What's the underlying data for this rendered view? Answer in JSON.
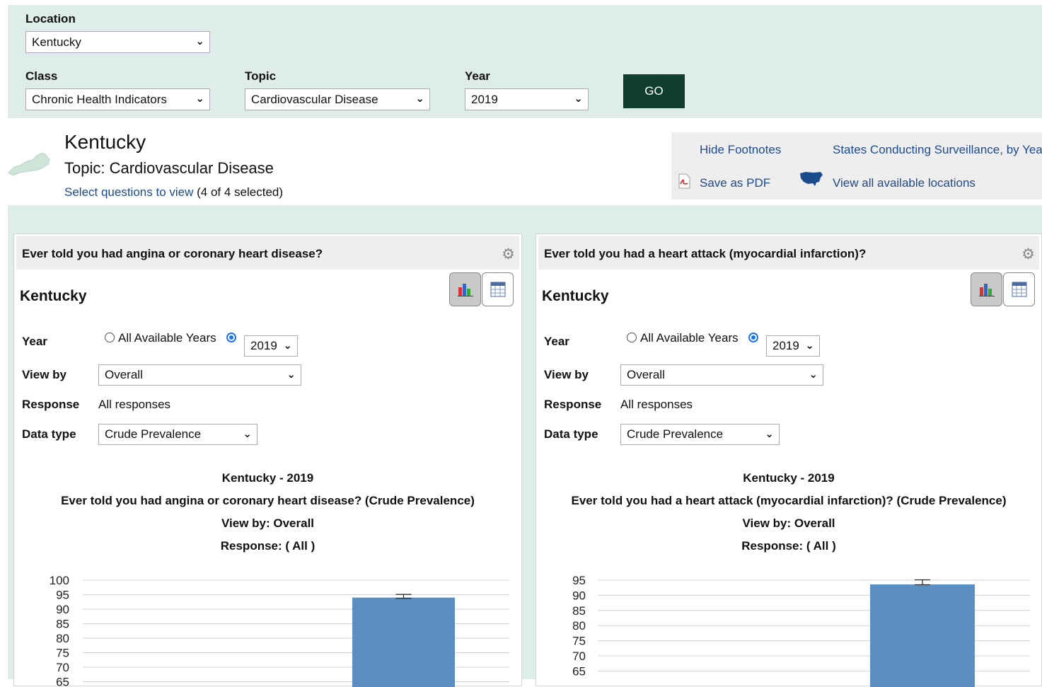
{
  "filters": {
    "location_label": "Location",
    "location_value": "Kentucky",
    "class_label": "Class",
    "class_value": "Chronic Health Indicators",
    "topic_label": "Topic",
    "topic_value": "Cardiovascular Disease",
    "year_label": "Year",
    "year_value": "2019",
    "go_label": "GO"
  },
  "header": {
    "state": "Kentucky",
    "topic": "Topic: Cardiovascular Disease",
    "select_link": "Select questions to view",
    "selected_count": "(4 of 4 selected)"
  },
  "links": {
    "hide_footnotes": "Hide Footnotes",
    "states_surveillance": "States Conducting Surveillance, by Year",
    "save_pdf": "Save as PDF",
    "view_locations": "View all available locations"
  },
  "icons": {
    "gear": "gear-icon",
    "bar_chart": "bar-chart-icon",
    "table": "table-icon",
    "pdf": "pdf-icon",
    "us_map": "us-map-icon",
    "state_map": "kentucky-map-icon"
  },
  "colors": {
    "band": "#dfede8",
    "go_button": "#0f3d2e",
    "link": "#1e4a8a",
    "bar": "#5b8fc3",
    "radio": "#1a73e8"
  },
  "panels": [
    {
      "question": "Ever told you had angina or coronary heart disease?",
      "state": "Kentucky",
      "year_label": "Year",
      "all_years_label": "All Available Years",
      "year_value": "2019",
      "viewby_label": "View by",
      "viewby_value": "Overall",
      "response_label": "Response",
      "response_value": "All responses",
      "datatype_label": "Data type",
      "datatype_value": "Crude Prevalence",
      "chart_title_1": "Kentucky - 2019",
      "chart_title_2": "Ever told you had angina or coronary heart disease? (Crude Prevalence)",
      "chart_title_3": "View by: Overall",
      "chart_title_4": "Response: ( All )"
    },
    {
      "question": "Ever told you had a heart attack (myocardial infarction)?",
      "state": "Kentucky",
      "year_label": "Year",
      "all_years_label": "All Available Years",
      "year_value": "2019",
      "viewby_label": "View by",
      "viewby_value": "Overall",
      "response_label": "Response",
      "response_value": "All responses",
      "datatype_label": "Data type",
      "datatype_value": "Crude Prevalence",
      "chart_title_1": "Kentucky - 2019",
      "chart_title_2": "Ever told you had a heart attack (myocardial infarction)? (Crude Prevalence)",
      "chart_title_3": "View by: Overall",
      "chart_title_4": "Response: ( All )"
    }
  ],
  "chart_data": [
    {
      "type": "bar",
      "title": "Kentucky - 2019",
      "yticks": [
        100,
        95,
        90,
        85,
        80,
        75,
        70,
        65
      ],
      "ylim": [
        65,
        100
      ],
      "grid": true,
      "series": [
        {
          "values": [
            94
          ],
          "error": [
            93.7,
            95.1
          ]
        }
      ]
    },
    {
      "type": "bar",
      "title": "Kentucky - 2019",
      "yticks": [
        95,
        90,
        85,
        80,
        75,
        70,
        65
      ],
      "ylim": [
        65,
        95
      ],
      "grid": true,
      "series": [
        {
          "values": [
            93.6
          ],
          "error": [
            93.5,
            95.1
          ]
        }
      ]
    }
  ]
}
